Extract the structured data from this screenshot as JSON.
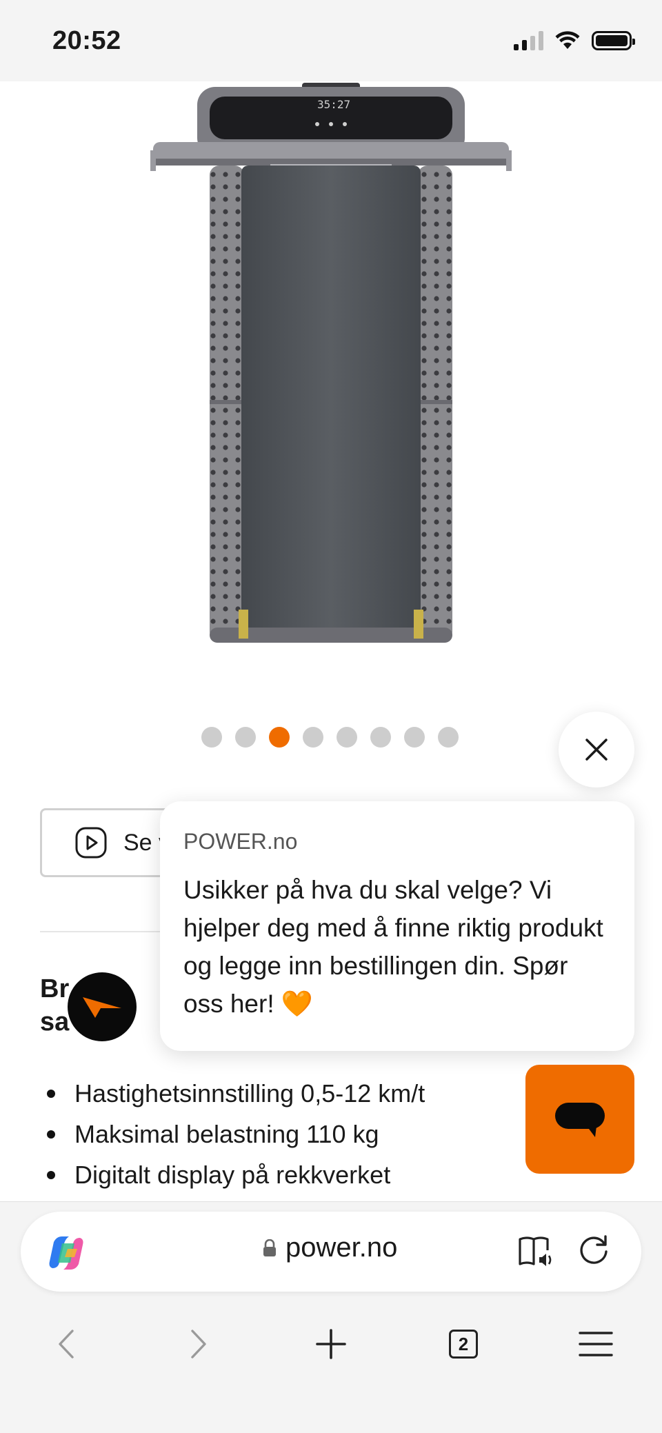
{
  "status_bar": {
    "time": "20:52"
  },
  "carousel": {
    "total": 8,
    "active_index": 2
  },
  "video_button": {
    "label": "Se v"
  },
  "heading": {
    "line1": "Br      ve",
    "line2": "sa       en"
  },
  "features": [
    "Hastighetsinnstilling 0,5-12 km/t",
    "Maksimal belastning 110 kg",
    "Digitalt display på rekkverket"
  ],
  "chat_popup": {
    "source": "POWER.no",
    "message": "Usikker på hva du skal velge? Vi hjelper deg med å finne riktig produkt og legge inn bestillingen din. Spør oss her! 🧡"
  },
  "browser": {
    "url": "power.no",
    "tab_count": "2"
  },
  "product_display": {
    "readout": "35:27"
  },
  "colors": {
    "accent": "#ef6c00",
    "dot_inactive": "#cdcdcd",
    "chrome_bg": "#f4f4f4"
  }
}
